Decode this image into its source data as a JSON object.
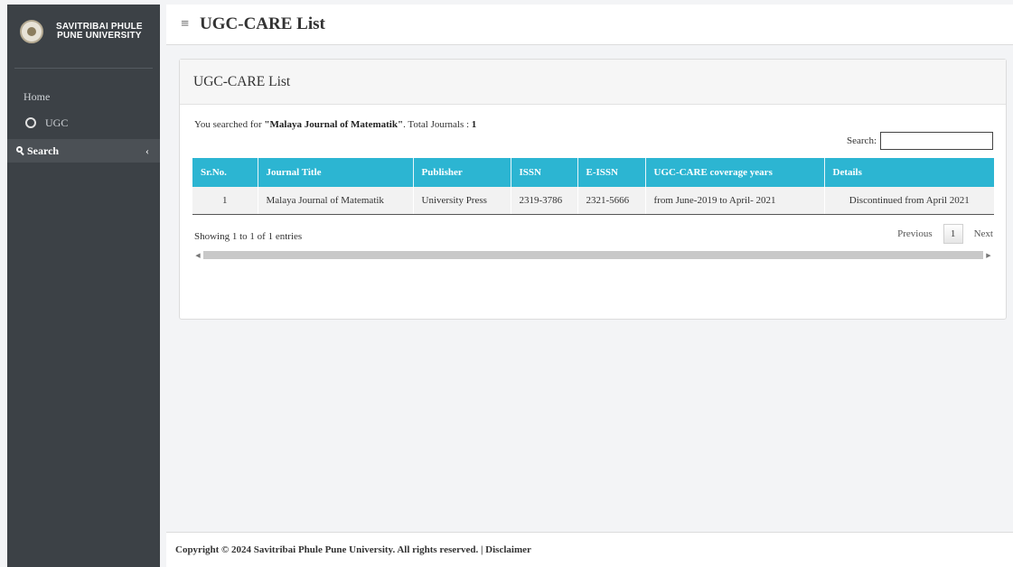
{
  "sidebar": {
    "brand_line1": "SAVITRIBAI PHULE",
    "brand_line2": "PUNE UNIVERSITY",
    "home_label": "Home",
    "ugc_label": "UGC",
    "search_label": "Search",
    "chevron": "‹"
  },
  "header": {
    "menu_icon": "≡",
    "title": "UGC-CARE List"
  },
  "card": {
    "title": "UGC-CARE List",
    "searched_prefix": "You searched for ",
    "searched_query": "\"Malaya Journal of Matematik\"",
    "searched_suffix": ". Total Journals : ",
    "total_journals": "1",
    "search_label": "Search:",
    "search_value": ""
  },
  "table": {
    "headers": [
      "Sr.No.",
      "Journal Title",
      "Publisher",
      "ISSN",
      "E-ISSN",
      "UGC-CARE coverage years",
      "Details"
    ],
    "rows": [
      [
        "1",
        "Malaya Journal of Matematik",
        "University Press",
        "2319-3786",
        "2321-5666",
        "from June-2019 to April- 2021",
        "Discontinued from April 2021"
      ]
    ]
  },
  "pagination": {
    "info": "Showing 1 to 1 of 1 entries",
    "previous": "Previous",
    "current_page": "1",
    "next": "Next"
  },
  "footer": {
    "text": "Copyright © 2024 Savitribai Phule Pune University. All rights reserved. | Disclaimer"
  },
  "colors": {
    "sidebar_bg": "#3c4146",
    "table_header": "#2cb5d2"
  }
}
